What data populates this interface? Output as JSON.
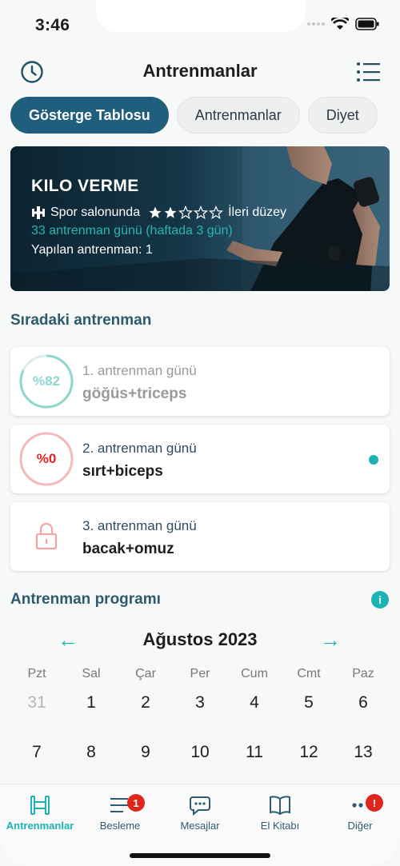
{
  "status": {
    "time": "3:46"
  },
  "header": {
    "title": "Antrenmanlar"
  },
  "tabs": [
    {
      "label": "Gösterge Tablosu",
      "active": true
    },
    {
      "label": "Antrenmanlar",
      "active": false
    },
    {
      "label": "Diyet",
      "active": false
    }
  ],
  "hero": {
    "title": "KILO VERME",
    "location": "Spor salonunda",
    "stars_filled": 2,
    "stars_total": 5,
    "level": "İleri düzey",
    "days": "33 antrenman günü (haftada 3 gün)",
    "done": "Yapılan antrenman: 1"
  },
  "next": {
    "title": "Sıradaki antrenman",
    "cards": [
      {
        "progress_label": "%82",
        "progress": 0.82,
        "sub": "1. antrenman günü",
        "name": "göğüs+triceps"
      },
      {
        "progress_label": "%0",
        "progress": 0,
        "sub": "2. antrenman günü",
        "name": "sırt+biceps"
      },
      {
        "sub": "3. antrenman günü",
        "name": "bacak+omuz",
        "locked": true
      }
    ]
  },
  "program": {
    "title": "Antrenman programı",
    "info_icon": "i"
  },
  "calendar": {
    "month": "Ağustos 2023",
    "prev": "←",
    "next": "→",
    "weekdays": [
      "Pzt",
      "Sal",
      "Çar",
      "Per",
      "Cum",
      "Cmt",
      "Paz"
    ],
    "week1": [
      "31",
      "1",
      "2",
      "3",
      "4",
      "5",
      "6"
    ],
    "week2": [
      "7",
      "8",
      "9",
      "10",
      "11",
      "12",
      "13"
    ]
  },
  "nav": {
    "items": [
      {
        "label": "Antrenmanlar",
        "icon": "dumbbell-icon"
      },
      {
        "label": "Besleme",
        "icon": "list-icon",
        "badge": "1"
      },
      {
        "label": "Mesajlar",
        "icon": "chat-icon"
      },
      {
        "label": "El Kitabı",
        "icon": "book-icon"
      },
      {
        "label": "Diğer",
        "icon": "more-icon",
        "badge": "!"
      }
    ]
  },
  "colors": {
    "accent": "#1bb3b3",
    "primary": "#1f5f7d",
    "danger": "#e0251d"
  }
}
